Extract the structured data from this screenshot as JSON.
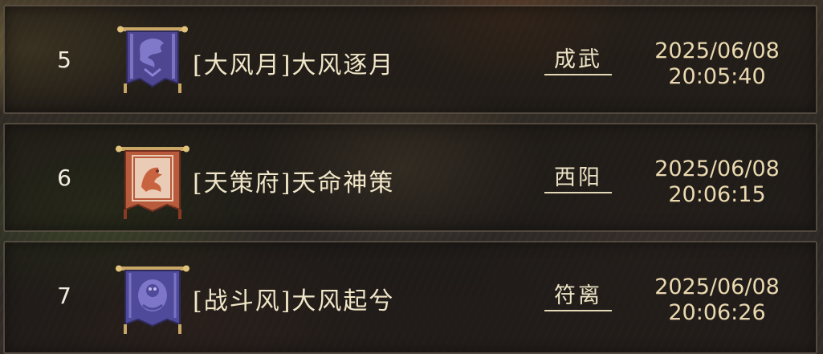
{
  "rows": [
    {
      "rank": "5",
      "guild": "[大风月]大风逐月",
      "server": "成武",
      "date": "2025/06/08",
      "time": "20:05:40",
      "banner_icon": "purple-dragon-banner-icon",
      "banner_color": "#4e4690"
    },
    {
      "rank": "6",
      "guild": "[天策府]天命神策",
      "server": "西阳",
      "date": "2025/06/08",
      "time": "20:06:15",
      "banner_icon": "red-phoenix-banner-icon",
      "banner_color": "#b85a3c"
    },
    {
      "rank": "7",
      "guild": "[战斗风]大风起兮",
      "server": "符离",
      "date": "2025/06/08",
      "time": "20:06:26",
      "banner_icon": "purple-beast-banner-icon",
      "banner_color": "#4f4a9a"
    }
  ],
  "colors": {
    "text_primary": "#f0e6c8",
    "timestamp": "#ead9b0",
    "row_border": "#6e6455"
  }
}
